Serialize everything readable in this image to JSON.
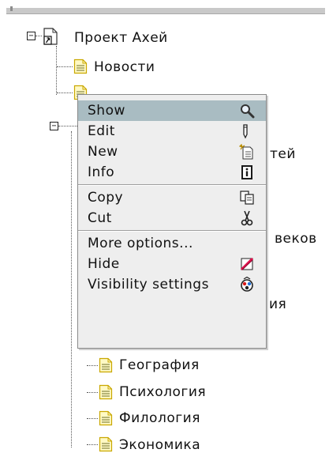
{
  "tree": {
    "root": {
      "label": "Проект Ахей",
      "expander": "−"
    },
    "second_expander": "−",
    "items": [
      {
        "label": "Новости"
      },
      {
        "label": "География"
      },
      {
        "label": "Психология"
      },
      {
        "label": "Филология"
      },
      {
        "label": "Экономика"
      }
    ],
    "partial": [
      {
        "label": "тей"
      },
      {
        "label": "веков"
      },
      {
        "label": "ия"
      }
    ]
  },
  "menu": {
    "items": [
      {
        "label": "Show",
        "icon": "magnifier-icon",
        "highlighted": true
      },
      {
        "label": "Edit",
        "icon": "pencil-icon"
      },
      {
        "label": "New",
        "icon": "new-document-icon"
      },
      {
        "label": "Info",
        "icon": "info-icon"
      },
      {
        "label": "Copy",
        "icon": "copy-icon"
      },
      {
        "label": "Cut",
        "icon": "scissors-icon"
      },
      {
        "label": "More options...",
        "icon": ""
      },
      {
        "label": "Hide",
        "icon": "hide-icon"
      },
      {
        "label": "Visibility settings",
        "icon": "visibility-settings-icon"
      }
    ]
  },
  "colors": {
    "menu_bg": "#eeeeee",
    "menu_highlight": "#a9bcc2",
    "doc_icon_fill": "#fff9c4",
    "doc_icon_border": "#c9a800"
  }
}
